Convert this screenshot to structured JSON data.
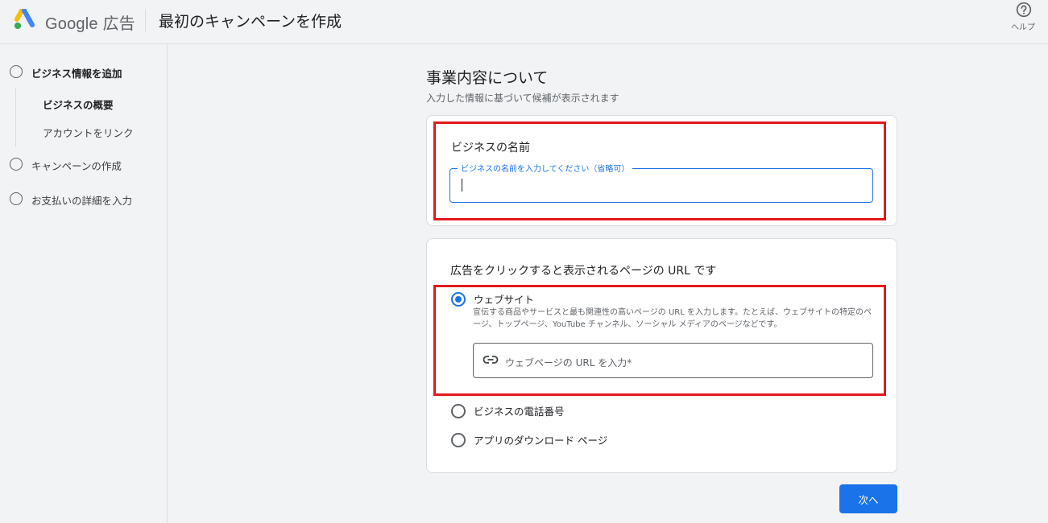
{
  "header": {
    "brand": "Google 広告",
    "title": "最初のキャンペーンを作成",
    "help_label": "ヘルプ"
  },
  "sidebar": {
    "steps": [
      {
        "label": "ビジネス情報を追加",
        "active": true
      },
      {
        "label": "キャンペーンの作成",
        "active": false
      },
      {
        "label": "お支払いの詳細を入力",
        "active": false
      }
    ],
    "substeps": [
      {
        "label": "ビジネスの概要",
        "active": true
      },
      {
        "label": "アカウントをリンク",
        "active": false
      }
    ]
  },
  "main": {
    "title": "事業内容について",
    "subtitle": "入力した情報に基づいて候補が表示されます",
    "business_name": {
      "heading": "ビジネスの名前",
      "label": "ビジネスの名前を入力してください（省略可）",
      "value": ""
    },
    "url_section": {
      "heading": "広告をクリックすると表示されるページの URL です",
      "options": [
        {
          "label": "ウェブサイト",
          "selected": true,
          "description": "宣伝する商品やサービスと最も関連性の高いページの URL を入力します。たとえば、ウェブサイトの特定のページ、トップページ、YouTube チャンネル、ソーシャル メディアのページなどです。"
        },
        {
          "label": "ビジネスの電話番号",
          "selected": false
        },
        {
          "label": "アプリのダウンロード ページ",
          "selected": false
        }
      ],
      "url_placeholder": "ウェブページの URL を入力*"
    },
    "next_label": "次へ"
  },
  "colors": {
    "accent": "#1a73e8",
    "highlight": "#e3191b",
    "background": "#f1f3f4"
  }
}
